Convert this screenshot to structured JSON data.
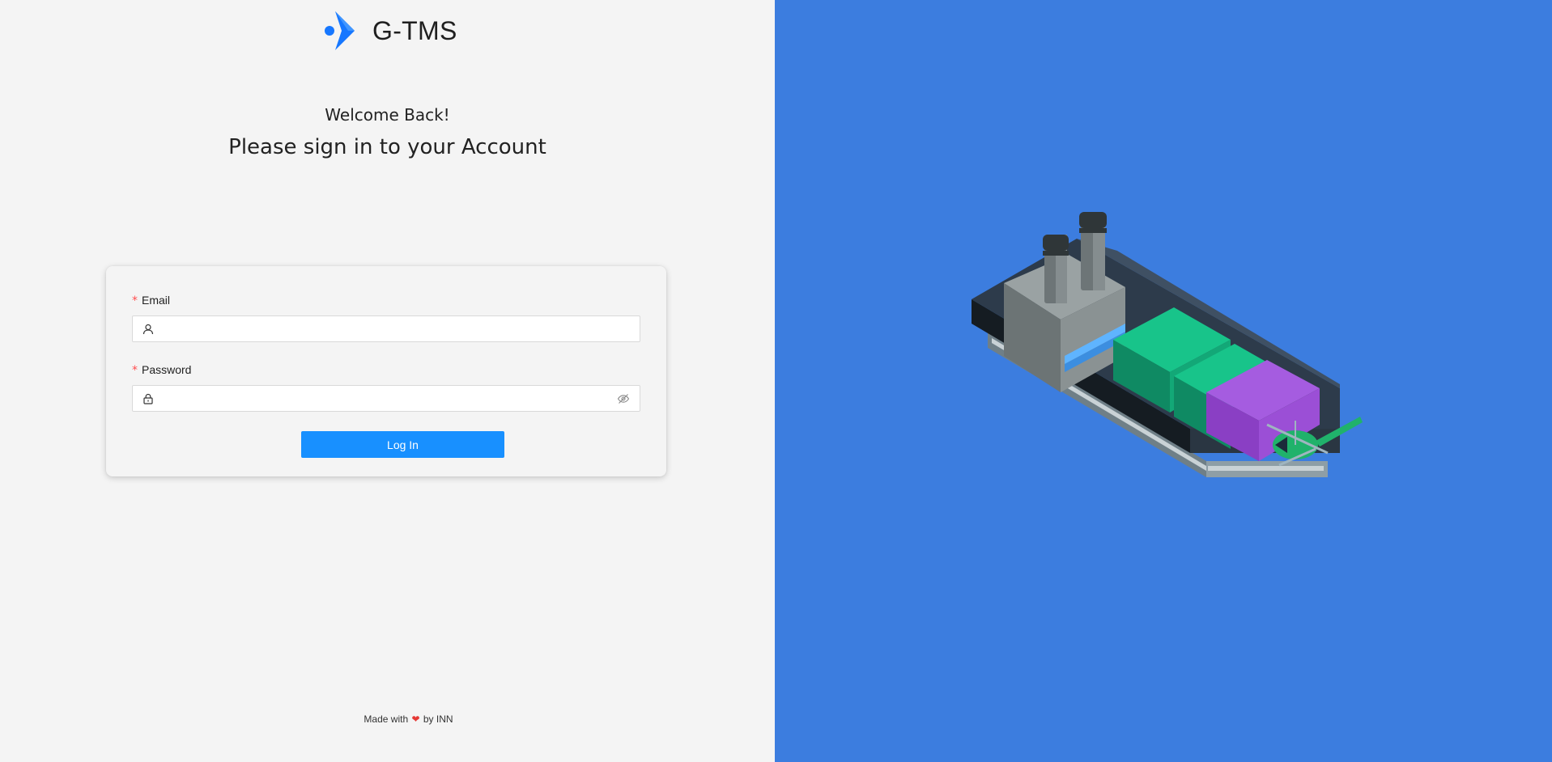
{
  "brand": {
    "name": "G-TMS",
    "logo_icon": "chevron-dot-logo-icon",
    "accent_color": "#1677ff"
  },
  "heading": {
    "welcome": "Welcome Back!",
    "subtitle": "Please sign in to your Account"
  },
  "form": {
    "email": {
      "label": "Email",
      "required_mark": "*",
      "value": "",
      "prefix_icon": "user-icon"
    },
    "password": {
      "label": "Password",
      "required_mark": "*",
      "value": "",
      "prefix_icon": "lock-icon",
      "suffix_icon": "eye-invisible-icon"
    },
    "submit_label": "Log In",
    "button_color": "#1890ff"
  },
  "footer": {
    "prefix": "Made with",
    "heart": "❤",
    "suffix": "by INN"
  },
  "illustration": {
    "icon": "container-ship-illustration",
    "background_color": "#3c7ddf"
  }
}
